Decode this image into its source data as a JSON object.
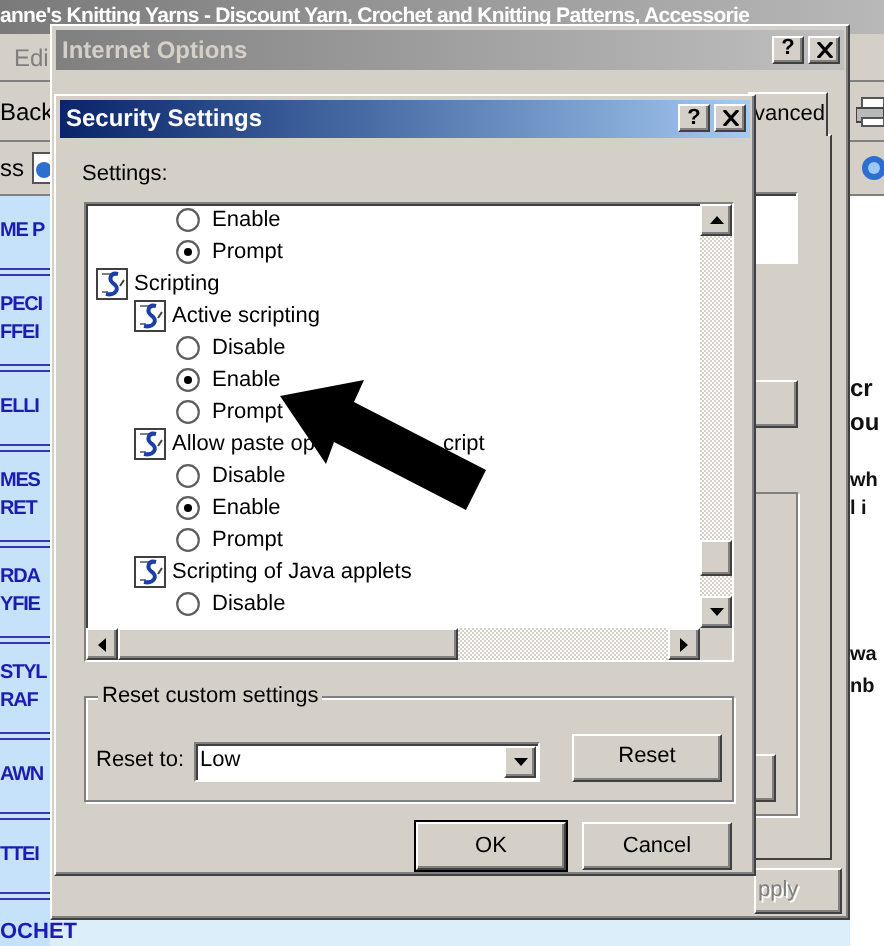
{
  "browser": {
    "title": "anne's Knitting Yarns - Discount Yarn, Crochet and Knitting Patterns, Accessorie",
    "menu": [
      "Edi"
    ],
    "toolbar": [
      "Back"
    ],
    "address_label": "ss",
    "nav_items": [
      [
        "ME P"
      ],
      [
        "PECI",
        "FFEI"
      ],
      [
        "ELLI"
      ],
      [
        "MES",
        "RET"
      ],
      [
        "RDA",
        "YFIE"
      ],
      [
        "STYL",
        "RAF"
      ],
      [
        "AWN"
      ],
      [
        "TTEI"
      ]
    ],
    "nav_bottom": "OCHET",
    "content_fragments": [
      [
        "cr",
        "ou"
      ],
      [
        "wh",
        "l i"
      ],
      [
        "wa",
        "nb"
      ]
    ]
  },
  "internet_options": {
    "title": "Internet Options",
    "help_button": "?",
    "tab": {
      "label": "vanced",
      "selected": true
    },
    "apply_button": {
      "label": "pply",
      "disabled": true
    }
  },
  "security_settings": {
    "title": "Security Settings",
    "help_button": "?",
    "settings_label": "Settings:",
    "items": [
      {
        "kind": "radio",
        "label": "Enable",
        "selected": false
      },
      {
        "kind": "radio",
        "label": "Prompt",
        "selected": true
      },
      {
        "kind": "category",
        "label": "Scripting",
        "children": [
          {
            "kind": "setting",
            "label": "Active scripting",
            "children": [
              {
                "kind": "radio",
                "label": "Disable",
                "selected": false
              },
              {
                "kind": "radio",
                "label": "Enable",
                "selected": true
              },
              {
                "kind": "radio",
                "label": "Prompt",
                "selected": false
              }
            ]
          },
          {
            "kind": "setting",
            "label": "Allow paste op",
            "label_tail": "cript",
            "children": [
              {
                "kind": "radio",
                "label": "Disable",
                "selected": false
              },
              {
                "kind": "radio",
                "label": "Enable",
                "selected": true
              },
              {
                "kind": "radio",
                "label": "Prompt",
                "selected": false
              }
            ]
          },
          {
            "kind": "setting",
            "label": "Scripting of Java applets",
            "children": [
              {
                "kind": "radio",
                "label": "Disable",
                "selected": false
              }
            ]
          }
        ]
      }
    ],
    "reset": {
      "group_label": "Reset custom settings",
      "label": "Reset to:",
      "value": "Low",
      "button": "Reset"
    },
    "buttons": [
      {
        "label": "OK",
        "default": true
      },
      {
        "label": "Cancel",
        "default": false
      }
    ]
  }
}
